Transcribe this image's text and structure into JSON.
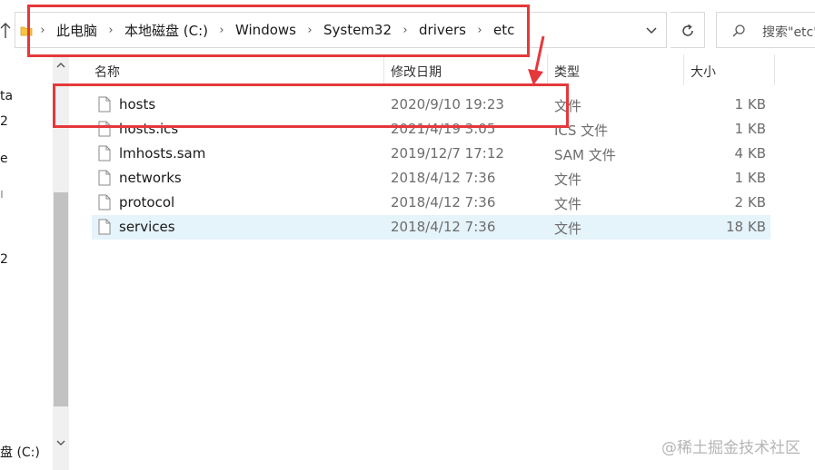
{
  "address_bar": {
    "breadcrumbs": [
      "此电脑",
      "本地磁盘 (C:)",
      "Windows",
      "System32",
      "drivers",
      "etc"
    ],
    "search_placeholder": "搜索\"etc\""
  },
  "nav_pane": {
    "fragments": [
      "ta",
      "2",
      "e",
      "2",
      "盘 (C:)"
    ]
  },
  "columns": {
    "name": "名称",
    "date": "修改日期",
    "type": "类型",
    "size": "大小"
  },
  "files": [
    {
      "name": "hosts",
      "date": "2020/9/10 19:23",
      "type": "文件",
      "size": "1 KB",
      "selected": false
    },
    {
      "name": "hosts.ics",
      "date": "2021/4/19 3:05",
      "type": "ICS 文件",
      "size": "1 KB",
      "selected": false
    },
    {
      "name": "lmhosts.sam",
      "date": "2019/12/7 17:12",
      "type": "SAM 文件",
      "size": "4 KB",
      "selected": false
    },
    {
      "name": "networks",
      "date": "2018/4/12 7:36",
      "type": "文件",
      "size": "1 KB",
      "selected": false
    },
    {
      "name": "protocol",
      "date": "2018/4/12 7:36",
      "type": "文件",
      "size": "2 KB",
      "selected": false
    },
    {
      "name": "services",
      "date": "2018/4/12 7:36",
      "type": "文件",
      "size": "18 KB",
      "selected": true
    }
  ],
  "watermark": "@稀土掘金技术社区",
  "colors": {
    "annotation_red": "#e5383b",
    "selection_bg": "#e5f3fb"
  }
}
